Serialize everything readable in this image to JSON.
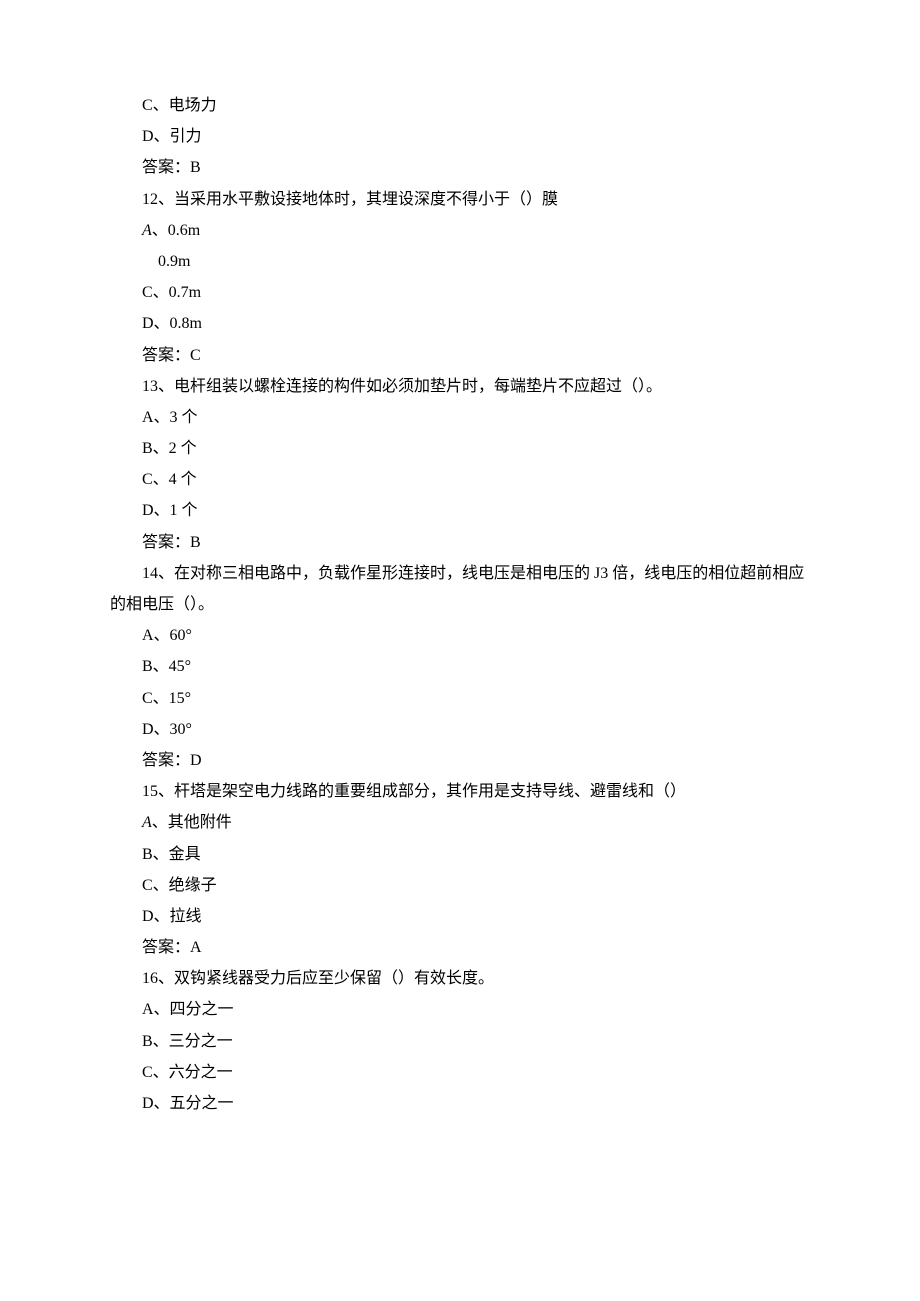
{
  "lines": [
    "C、电场力",
    "D、引力",
    "答案：B",
    "12、当采用水平敷设接地体时，其埋设深度不得小于（）膜",
    "A、0.6m",
    "    0.9m",
    "C、0.7m",
    "D、0.8m",
    "答案：C",
    "13、电杆组装以螺栓连接的构件如必须加垫片时，每端垫片不应超过（）。",
    "A、3 个",
    "B、2 个",
    "C、4 个",
    "D、1 个",
    "答案：B",
    "14、在对称三相电路中，负载作星形连接时，线电压是相电压的 J3 倍，线电压的相位超前相应的相电压（）。",
    "A、60°",
    "B、45°",
    "C、15°",
    "D、30°",
    "答案：D",
    "15、杆塔是架空电力线路的重要组成部分，其作用是支持导线、避雷线和（）",
    "A、其他附件",
    "B、金具",
    "C、绝缘子",
    "D、拉线",
    "答案：A",
    "16、双钩紧线器受力后应至少保留（）有效长度。",
    "A、四分之一",
    "B、三分之一",
    "C、六分之一",
    "D、五分之一"
  ],
  "italicA": [
    4,
    22
  ],
  "wrap": {
    "15": true,
    "21": true
  }
}
